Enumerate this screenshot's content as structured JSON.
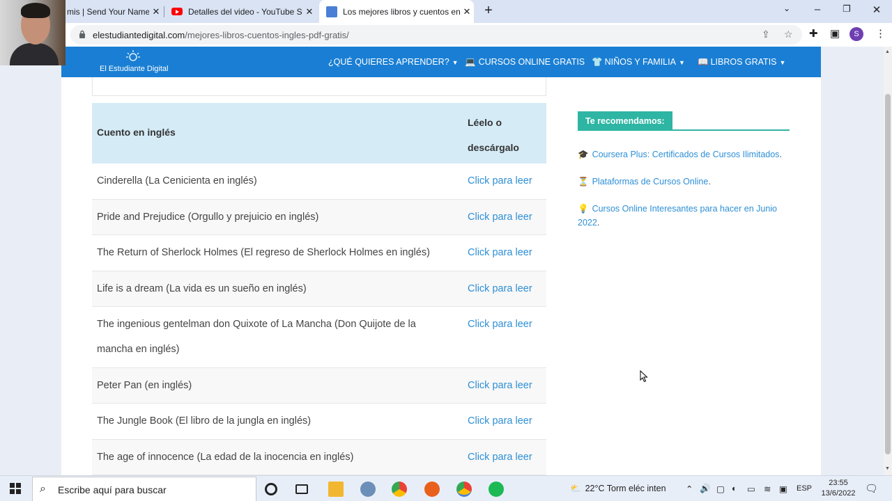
{
  "browser": {
    "tabs": [
      {
        "title": "mis | Send Your Name",
        "active": false
      },
      {
        "title": "Detalles del video - YouTube Stud",
        "active": false
      },
      {
        "title": "Los mejores libros y cuentos en i",
        "active": true
      }
    ],
    "url_domain": "elestudiantedigital.com",
    "url_path": "/mejores-libros-cuentos-ingles-pdf-gratis/",
    "profile_initial": "S"
  },
  "site": {
    "logo_text": "El Estudiante Digital",
    "nav": [
      {
        "label": "¿QUÉ QUIERES APRENDER?",
        "has_dropdown": true
      },
      {
        "label": "CURSOS ONLINE GRATIS",
        "has_dropdown": false
      },
      {
        "label": "NIÑOS Y FAMILIA",
        "has_dropdown": true
      },
      {
        "label": "LIBROS GRATIS",
        "has_dropdown": true
      }
    ]
  },
  "table": {
    "header_col1": "Cuento en inglés",
    "header_col2": "Léelo o descárgalo",
    "rows": [
      {
        "title": "Cinderella (La Cenicienta en inglés)",
        "link": "Click para leer"
      },
      {
        "title": "Pride and Prejudice (Orgullo y prejuicio en inglés)",
        "link": "Click para leer"
      },
      {
        "title": "The Return of Sherlock Holmes (El regreso de Sherlock Holmes en inglés)",
        "link": "Click para leer"
      },
      {
        "title": "Life is a dream (La vida es un sueño en inglés)",
        "link": "Click para leer"
      },
      {
        "title": "The ingenious gentelman don Quixote of La Mancha (Don Quijote de la mancha en inglés)",
        "link": "Click para leer"
      },
      {
        "title": "Peter Pan (en inglés)",
        "link": "Click para leer"
      },
      {
        "title": "The Jungle Book (El libro de la jungla en inglés)",
        "link": "Click para leer"
      },
      {
        "title": "The age of innocence (La edad de la inocencia en inglés)",
        "link": "Click para leer"
      }
    ]
  },
  "sidebar": {
    "heading": "Te recomendamos:",
    "items": [
      {
        "icon": "graduation-cap-icon",
        "glyph": "🎓",
        "text": "Coursera Plus: Certificados de Cursos Ilimitados",
        "trail": "."
      },
      {
        "icon": "hourglass-icon",
        "glyph": "⏳",
        "text": "Plataformas de Cursos Online",
        "trail": "."
      },
      {
        "icon": "lightbulb-icon",
        "glyph": "💡",
        "text": "Cursos Online Interesantes para hacer en Junio 2022",
        "trail": "."
      }
    ]
  },
  "taskbar": {
    "search_placeholder": "Escribe aquí para buscar",
    "weather": "22°C  Torm eléc inten",
    "language": "ESP",
    "time": "23:55",
    "date": "13/6/2022"
  },
  "colors": {
    "nav_blue": "#1a7fd4",
    "link_blue": "#2d8fd5",
    "table_header_bg": "#d5ebf6",
    "sidebar_accent": "#2eb5a3"
  }
}
